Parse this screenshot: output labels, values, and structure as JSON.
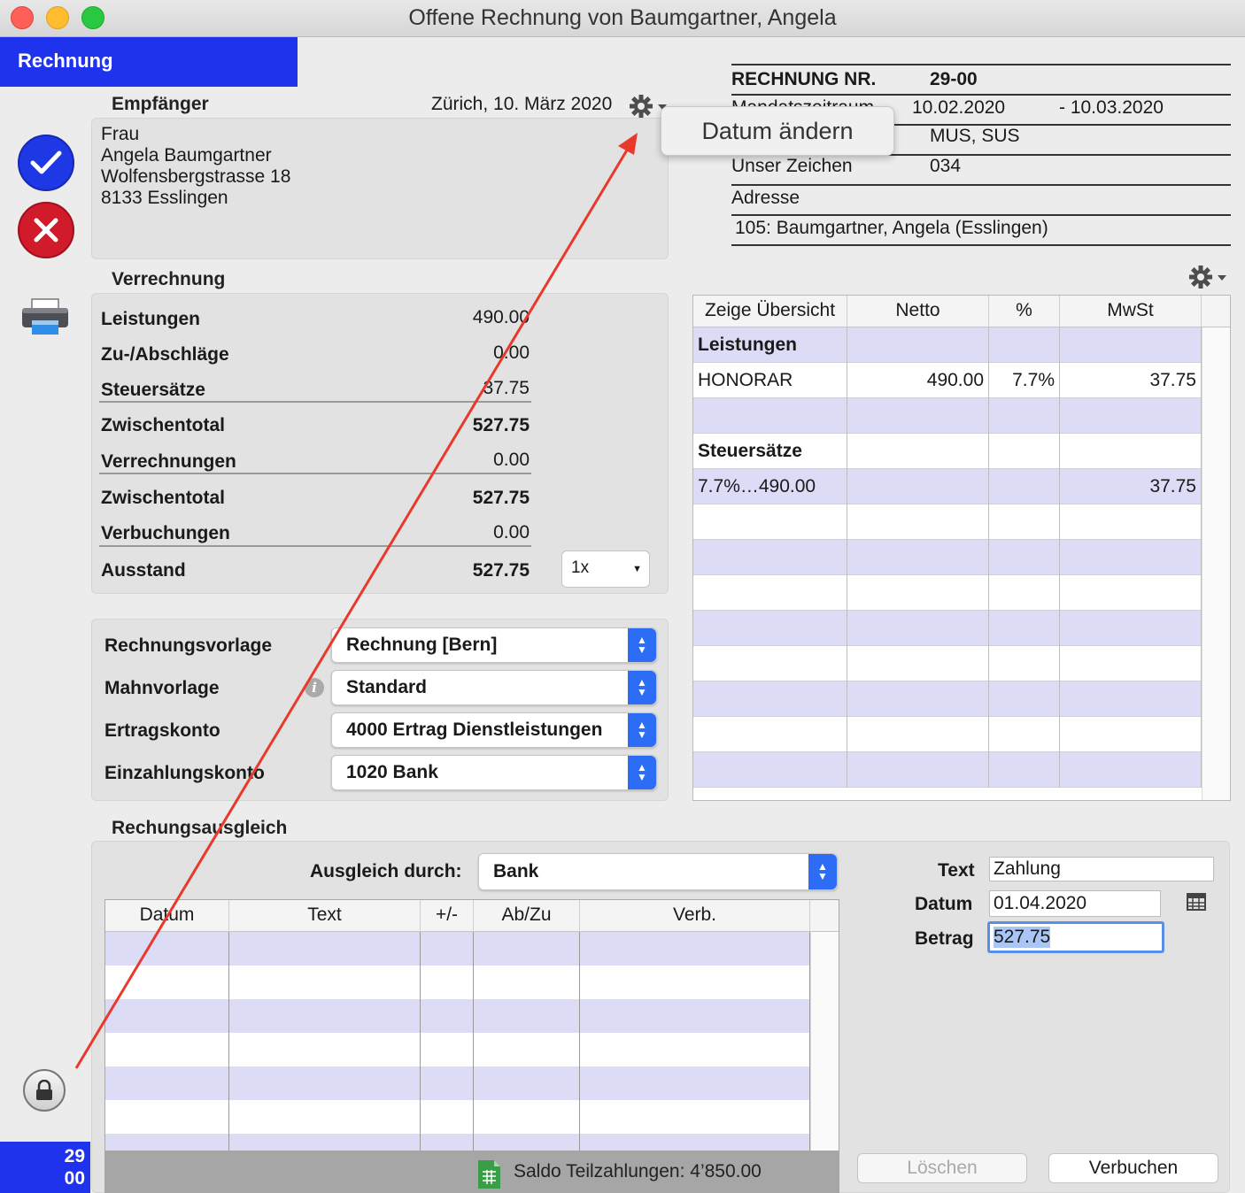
{
  "window": {
    "title": "Offene Rechnung von Baumgartner, Angela"
  },
  "tab": {
    "label": "Rechnung"
  },
  "badge": {
    "line1": "29",
    "line2": "00"
  },
  "recipient": {
    "heading": "Empfänger",
    "date": "Zürich, 10. März 2020",
    "lines": [
      "Frau",
      "Angela Baumgartner",
      "Wolfensbergstrasse 18",
      "8133 Esslingen"
    ]
  },
  "tooltip": {
    "label": "Datum ändern"
  },
  "invoice_header": {
    "nr_label": "RECHNUNG NR.",
    "nr_value": "29-00",
    "period_label": "Mandatszeitraum",
    "period_from": "10.02.2020",
    "period_to": "- 10.03.2020",
    "signs_value": "MUS, SUS",
    "our_sign_label": "Unser Zeichen",
    "our_sign_value": "034",
    "address_label": "Adresse",
    "address_value": "105: Baumgartner, Angela (Esslingen)"
  },
  "settlement": {
    "heading": "Verrechnung",
    "rows": [
      {
        "label": "Leistungen",
        "value": "490.00"
      },
      {
        "label": "Zu-/Abschläge",
        "value": "0.00"
      },
      {
        "label": "Steuersätze",
        "value": "37.75"
      },
      {
        "label": "Zwischentotal",
        "value": "527.75"
      },
      {
        "label": "Verrechnungen",
        "value": "0.00"
      },
      {
        "label": "Zwischentotal",
        "value": "527.75"
      },
      {
        "label": "Verbuchungen",
        "value": "0.00"
      },
      {
        "label": "Ausstand",
        "value": "527.75"
      }
    ],
    "copies_select": "1x"
  },
  "templates": {
    "rows": [
      {
        "label": "Rechnungsvorlage",
        "value": "Rechnung [Bern]"
      },
      {
        "label": "Mahnvorlage",
        "value": "Standard"
      },
      {
        "label": "Ertragskonto",
        "value": "4000 Ertrag Dienstleistungen"
      },
      {
        "label": "Einzahlungskonto",
        "value": "1020 Bank"
      }
    ]
  },
  "overview": {
    "columns": [
      "Zeige Übersicht",
      "Netto",
      "%",
      "MwSt"
    ],
    "rows": [
      [
        "Leistungen",
        "",
        "",
        ""
      ],
      [
        "HONORAR",
        "490.00",
        "7.7%",
        "37.75"
      ],
      [
        "",
        "",
        "",
        ""
      ],
      [
        "Steuersätze",
        "",
        "",
        ""
      ],
      [
        "7.7%…490.00",
        "",
        "",
        "37.75"
      ],
      [
        "",
        "",
        "",
        ""
      ],
      [
        "",
        "",
        "",
        ""
      ],
      [
        "",
        "",
        "",
        ""
      ],
      [
        "",
        "",
        "",
        ""
      ],
      [
        "",
        "",
        "",
        ""
      ],
      [
        "",
        "",
        "",
        ""
      ],
      [
        "",
        "",
        "",
        ""
      ],
      [
        "",
        "",
        "",
        ""
      ]
    ]
  },
  "payment": {
    "heading": "Rechungsausgleich",
    "method_label": "Ausgleich durch:",
    "method_value": "Bank",
    "columns": [
      "Datum",
      "Text",
      "+/-",
      "Ab/Zu",
      "Verb."
    ],
    "saldo": "Saldo Teilzahlungen: 4’850.00",
    "text_label": "Text",
    "text_value": "Zahlung",
    "date_label": "Datum",
    "date_value": "01.04.2020",
    "amount_label": "Betrag",
    "amount_value": "527.75",
    "delete_label": "Löschen",
    "post_label": "Verbuchen"
  },
  "colors": {
    "accent": "#1f33ef",
    "row_stripe": "#dcdcf7",
    "annotation_arrow": "#e8392c"
  }
}
